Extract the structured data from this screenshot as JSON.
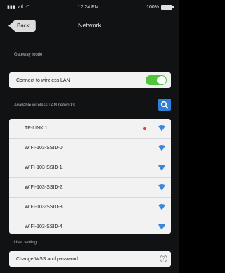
{
  "status_bar": {
    "carrier": "atl",
    "time": "12:24 PM",
    "battery_label": "100%"
  },
  "nav": {
    "back_label": "Back",
    "title": "Network"
  },
  "gateway_mode": {
    "section_label": "Gateway mode",
    "wireless_label": "Connect to wireless LAN",
    "wireless_enabled": true
  },
  "available": {
    "section_label": "Available wireless LAN networks",
    "networks": [
      {
        "name": "TP-LINK 1",
        "locked": true
      },
      {
        "name": "WIFI-103-SSID-0",
        "locked": false
      },
      {
        "name": "WIFI-103-SSID-1",
        "locked": false
      },
      {
        "name": "WIFI-103-SSID-2",
        "locked": false
      },
      {
        "name": "WIFI-103-SSID-3",
        "locked": false
      },
      {
        "name": "WIFI-103-SSID-4",
        "locked": false
      }
    ]
  },
  "user_setting": {
    "section_label": "User setting",
    "reset_label": "Change WSS and password"
  },
  "colors": {
    "accent": "#2f7fd6",
    "toggle_on": "#4fc43c",
    "lock_dot": "#e23c3c"
  }
}
